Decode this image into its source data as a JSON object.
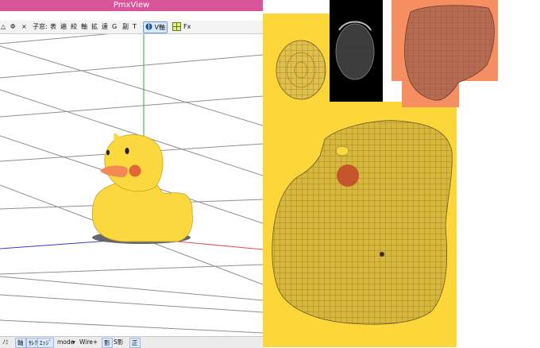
{
  "window": {
    "title": "PmxView"
  },
  "toolbar": {
    "items": [
      "△",
      "Φ",
      "×",
      "子窓:",
      "表",
      "遍",
      "絞",
      "軸",
      "拡",
      "遠",
      "G",
      "副",
      "T"
    ],
    "v_axis": "V軸",
    "fx": "Fx"
  },
  "statusbar": {
    "items": [
      {
        "label": "ﾉﾐ",
        "active": false
      },
      {
        "label": "軸",
        "active": true
      },
      {
        "label": "ｾﾚｸﾄ",
        "active": true
      },
      {
        "label": "ｴｯｼﾞ",
        "active": true
      },
      {
        "label": "mode",
        "active": false
      },
      {
        "label": "Wire+",
        "active": false
      },
      {
        "label": "影",
        "active": true
      },
      {
        "label": "S影",
        "active": false
      },
      {
        "label": "正",
        "active": true
      }
    ]
  },
  "colors": {
    "title_bar": "#d8559a",
    "duck_body": "#fcd83f",
    "beak": "#f38a52",
    "cheek": "#e4643a",
    "uv_bg": "#fdd63a",
    "uv_wire": "#6b5a2a",
    "uv_orange": "#f58f62",
    "uv_black": "#000000"
  }
}
